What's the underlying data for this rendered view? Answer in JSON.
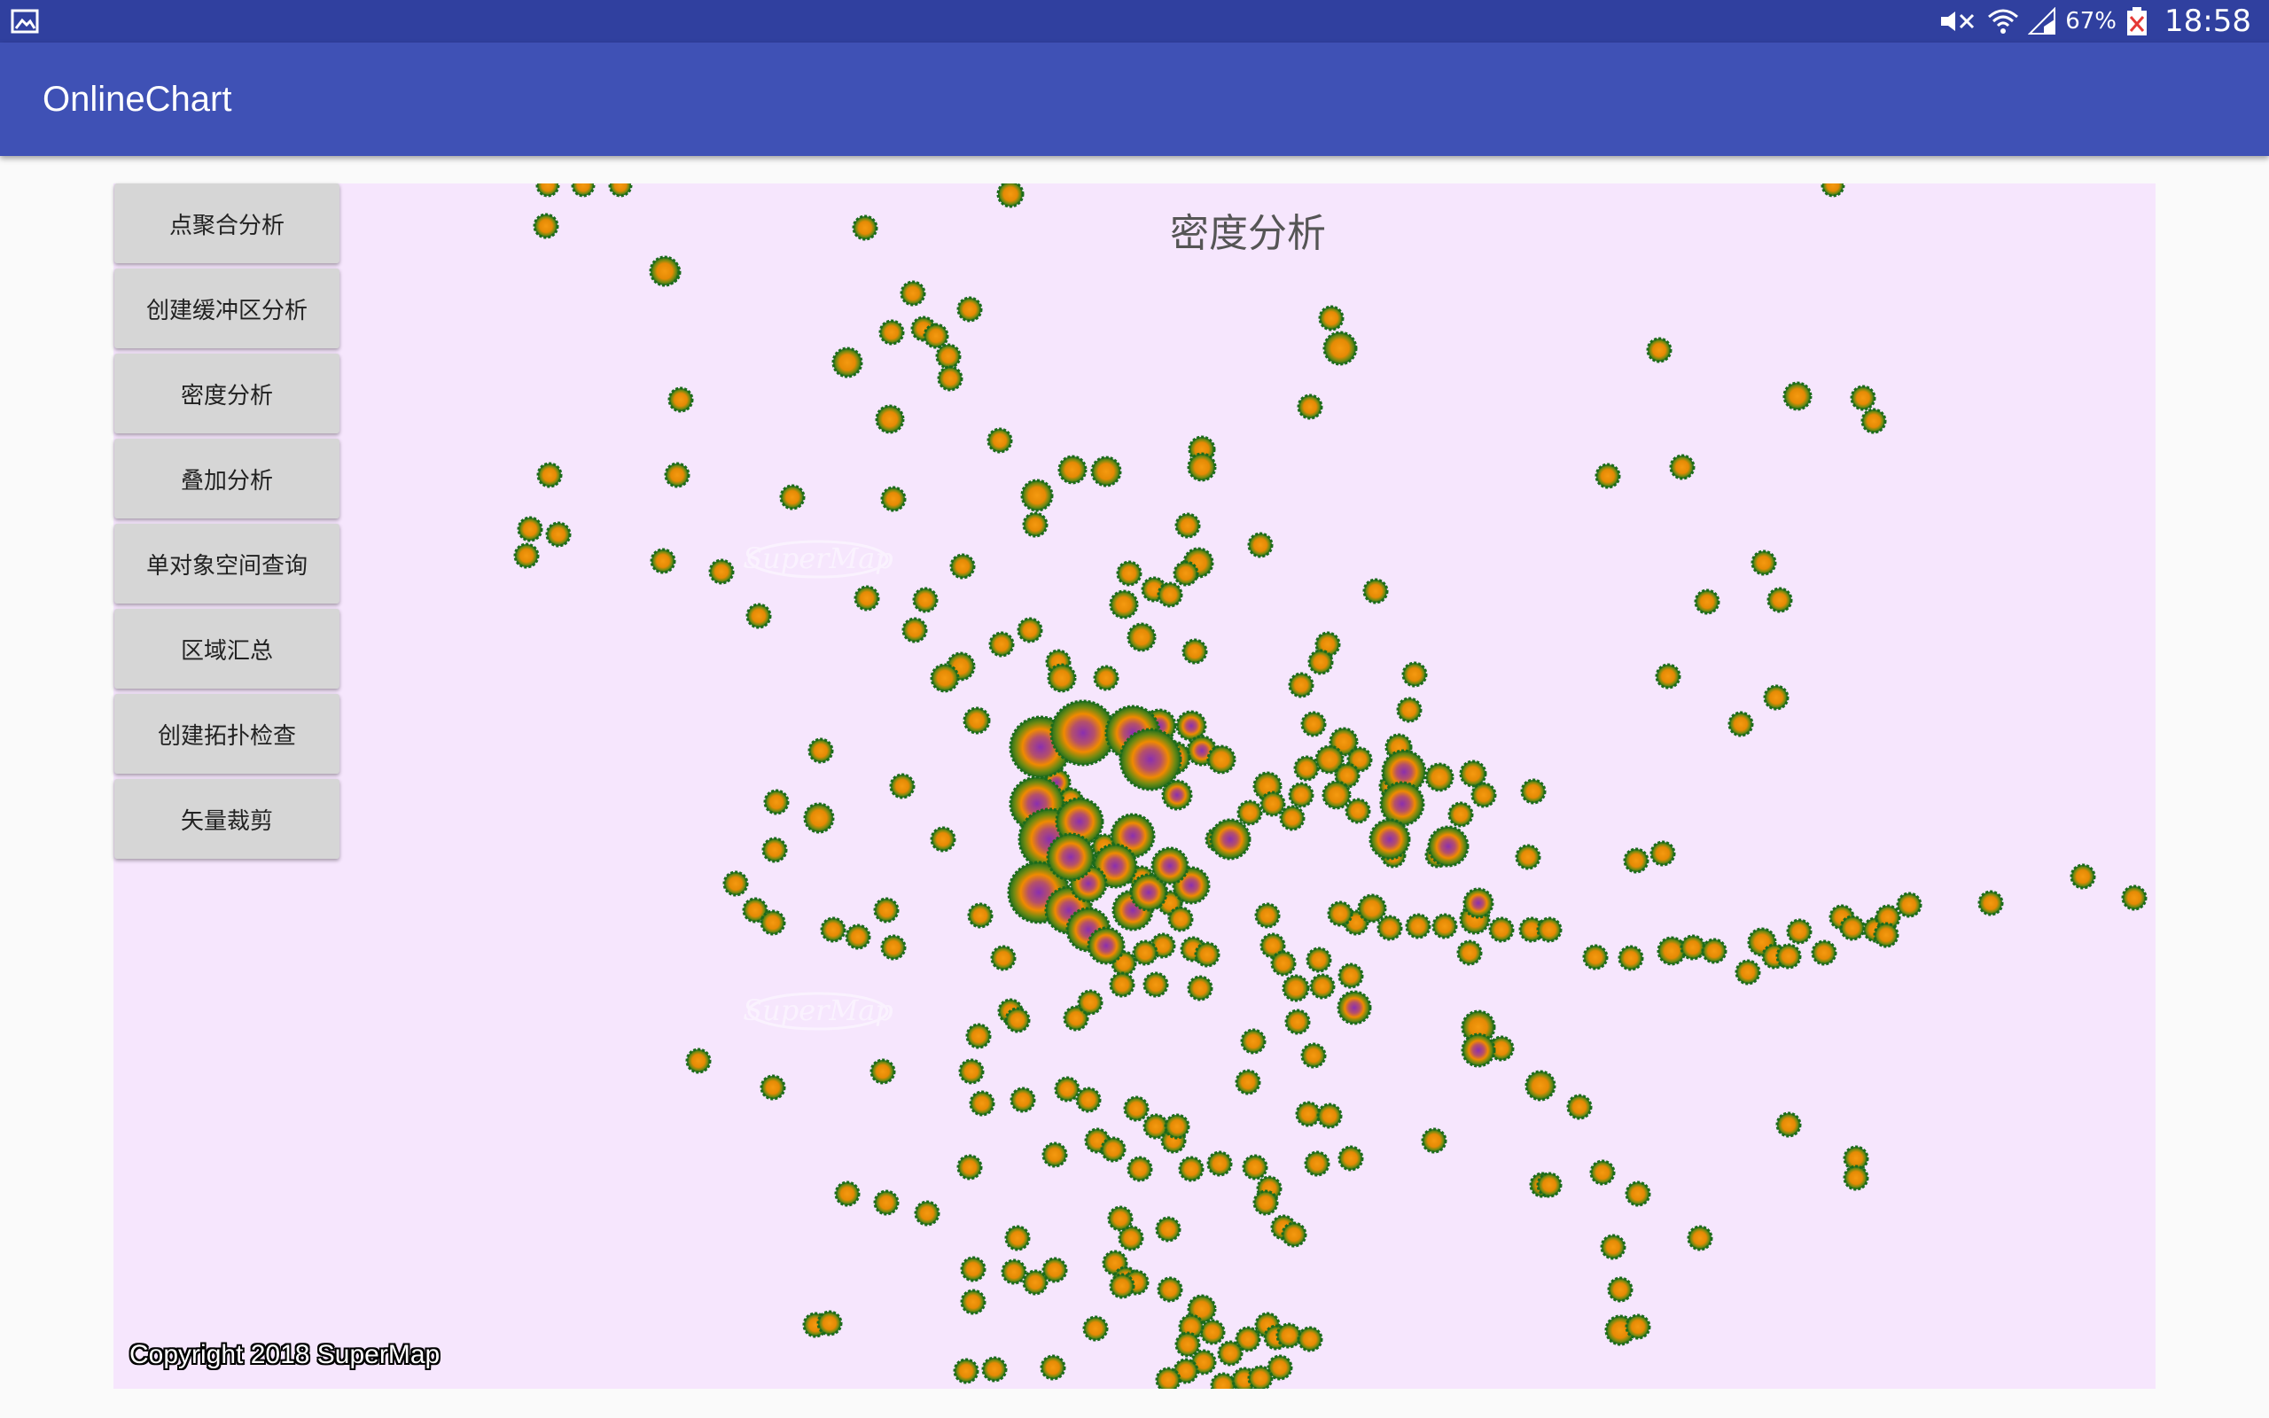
{
  "status_bar": {
    "battery": "67%",
    "time": "18:58",
    "icons": [
      "gallery-icon",
      "mute-icon",
      "wifi-icon",
      "signal-icon",
      "battery-icon"
    ]
  },
  "app_bar": {
    "title": "OnlineChart"
  },
  "menu": [
    {
      "id": "cluster",
      "label": "点聚合分析"
    },
    {
      "id": "buffer",
      "label": "创建缓冲区分析"
    },
    {
      "id": "density",
      "label": "密度分析"
    },
    {
      "id": "overlay",
      "label": "叠加分析"
    },
    {
      "id": "spatial-query",
      "label": "单对象空间查询"
    },
    {
      "id": "area-summary",
      "label": "区域汇总"
    },
    {
      "id": "topology",
      "label": "创建拓扑检查"
    },
    {
      "id": "clip",
      "label": "矢量裁剪"
    }
  ],
  "map": {
    "title": "密度分析",
    "copyright": "Copyright 2018 SuperMap",
    "watermark": "SuperMap",
    "colors": {
      "background": "#f6e6fd",
      "outer": "#1e7a1e",
      "mid": "#f08a00",
      "core": "#8a2fb0"
    }
  }
}
